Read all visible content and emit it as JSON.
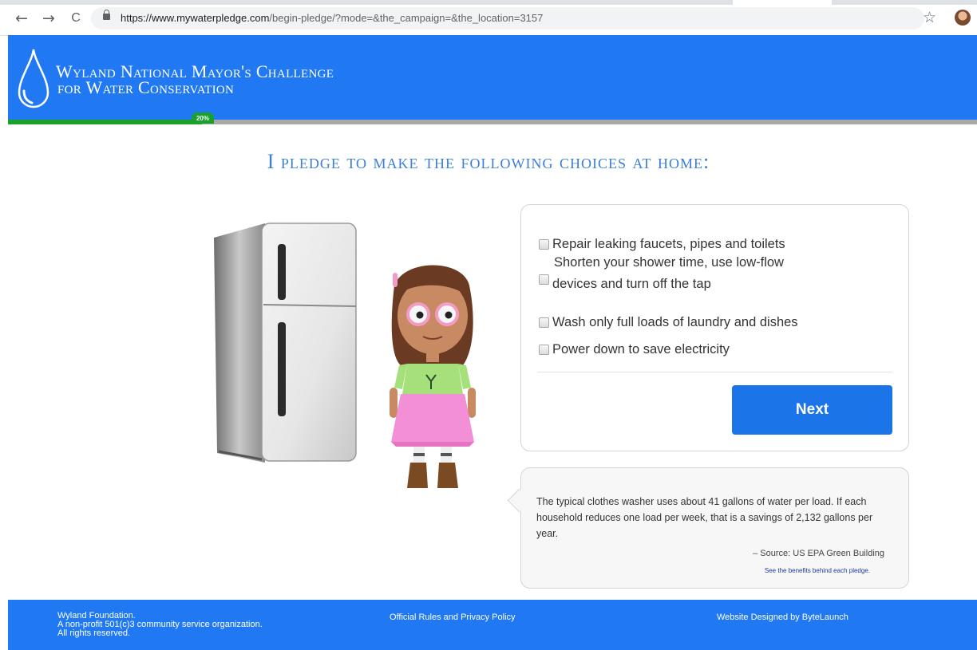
{
  "browser": {
    "url_host": "https://www.mywaterpledge.com",
    "url_path": "/begin-pledge/?mode=&the_campaign=&the_location=3157",
    "back_icon": "←",
    "forward_icon": "→",
    "reload_icon": "C",
    "star_icon": "☆"
  },
  "header": {
    "title_line1": "Wyland National Mayor's Challenge",
    "title_line2": "for Water Conservation",
    "progress_label": "20%",
    "progress_percent": 20,
    "bg_color": "#2079f2",
    "progress_color": "#1aa12b"
  },
  "main": {
    "title": "I pledge to make the following choices at home:",
    "options": [
      {
        "label": "Repair leaking faucets, pipes and toilets",
        "checked": false
      },
      {
        "label_line1": "Shorten your shower time, use low-flow",
        "label_line2": "devices and turn off the tap",
        "checked": false
      },
      {
        "label": "Wash only full loads of laundry and dishes",
        "checked": false
      },
      {
        "label": "Power down to save electricity",
        "checked": false
      }
    ],
    "next_label": "Next",
    "button_color": "#1c74e9"
  },
  "fact": {
    "text": "The typical clothes washer uses about 41 gallons of water per load. If each household reduces one load per week, that is a savings of 2,132 gallons per year.",
    "source": "– Source: US EPA Green Building",
    "link": "See the benefits behind each pledge."
  },
  "footer": {
    "left_line1": "Wyland Foundation.",
    "left_line2": "A non-profit 501(c)3 community service organization.",
    "left_line3": "All rights reserved.",
    "middle": "Official Rules and Privacy Policy",
    "right": "Website Designed by ByteLaunch"
  }
}
